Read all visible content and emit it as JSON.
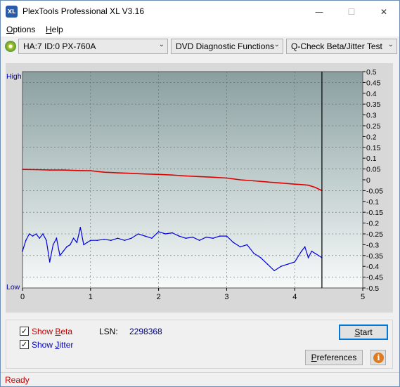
{
  "window": {
    "title": "PlexTools Professional XL V3.16",
    "icon_text": "XL",
    "minimize_glyph": "—",
    "maximize_glyph": "☐",
    "close_glyph": "✕"
  },
  "menu": {
    "items": [
      {
        "label": "Options",
        "accel": "O",
        "rest": "ptions"
      },
      {
        "label": "Help",
        "accel": "H",
        "rest": "elp"
      }
    ]
  },
  "toolbar": {
    "drive": "HA:7 ID:0  PX-760A",
    "function": "DVD Diagnostic Functions",
    "test": "Q-Check Beta/Jitter Test",
    "dropdown_glyph": "⌄"
  },
  "chart_data": {
    "type": "line",
    "title": "",
    "xlabel": "",
    "ylabel": "",
    "left_labels": {
      "high": "High",
      "low": "Low"
    },
    "xlim": [
      0,
      5
    ],
    "ylim": [
      -0.5,
      0.5
    ],
    "x_ticks": [
      "0",
      "1",
      "2",
      "3",
      "4",
      "5"
    ],
    "y_ticks": [
      "0.5",
      "0.45",
      "0.4",
      "0.35",
      "0.3",
      "0.25",
      "0.2",
      "0.15",
      "0.1",
      "0.05",
      "0",
      "-0.05",
      "-0.1",
      "-0.15",
      "-0.2",
      "-0.25",
      "-0.3",
      "-0.35",
      "-0.4",
      "-0.45",
      "-0.5"
    ],
    "grid": true,
    "end_marker_x": 4.4,
    "series": [
      {
        "name": "Beta",
        "color": "#e00000",
        "x": [
          0,
          0.2,
          0.4,
          0.6,
          0.8,
          1.0,
          1.2,
          1.4,
          1.6,
          1.8,
          2.0,
          2.2,
          2.4,
          2.6,
          2.8,
          3.0,
          3.2,
          3.4,
          3.6,
          3.8,
          4.0,
          4.1,
          4.2,
          4.3,
          4.4
        ],
        "values": [
          0.048,
          0.047,
          0.045,
          0.045,
          0.043,
          0.042,
          0.035,
          0.032,
          0.03,
          0.027,
          0.025,
          0.022,
          0.018,
          0.015,
          0.012,
          0.008,
          0.0,
          -0.005,
          -0.01,
          -0.015,
          -0.02,
          -0.022,
          -0.025,
          -0.035,
          -0.05
        ]
      },
      {
        "name": "Jitter",
        "color": "#0000e0",
        "x": [
          0,
          0.05,
          0.1,
          0.15,
          0.2,
          0.25,
          0.3,
          0.35,
          0.4,
          0.45,
          0.5,
          0.55,
          0.6,
          0.65,
          0.7,
          0.75,
          0.8,
          0.85,
          0.9,
          0.95,
          1.0,
          1.1,
          1.2,
          1.3,
          1.4,
          1.5,
          1.6,
          1.7,
          1.8,
          1.9,
          2.0,
          2.1,
          2.2,
          2.3,
          2.4,
          2.5,
          2.6,
          2.7,
          2.8,
          2.9,
          3.0,
          3.1,
          3.2,
          3.3,
          3.4,
          3.5,
          3.6,
          3.7,
          3.8,
          3.9,
          4.0,
          4.1,
          4.15,
          4.2,
          4.25,
          4.3,
          4.35,
          4.4
        ],
        "values": [
          -0.33,
          -0.28,
          -0.25,
          -0.26,
          -0.25,
          -0.27,
          -0.25,
          -0.28,
          -0.38,
          -0.3,
          -0.27,
          -0.35,
          -0.33,
          -0.31,
          -0.3,
          -0.27,
          -0.29,
          -0.22,
          -0.3,
          -0.29,
          -0.28,
          -0.28,
          -0.275,
          -0.28,
          -0.27,
          -0.28,
          -0.27,
          -0.25,
          -0.26,
          -0.27,
          -0.24,
          -0.25,
          -0.245,
          -0.26,
          -0.27,
          -0.265,
          -0.28,
          -0.265,
          -0.27,
          -0.26,
          -0.26,
          -0.29,
          -0.31,
          -0.3,
          -0.34,
          -0.36,
          -0.39,
          -0.42,
          -0.4,
          -0.39,
          -0.38,
          -0.33,
          -0.31,
          -0.36,
          -0.33,
          -0.34,
          -0.35,
          -0.36
        ]
      }
    ]
  },
  "options": {
    "show_beta": {
      "checked": true,
      "check_glyph": "✓",
      "pre": "Show ",
      "accel": "B",
      "rest": "eta",
      "color": "#c00000"
    },
    "show_jitter": {
      "checked": true,
      "check_glyph": "✓",
      "pre": "Show ",
      "accel": "J",
      "rest": "itter",
      "color": "#0000c0"
    },
    "lsn_label": "LSN:",
    "lsn_value": "2298368"
  },
  "buttons": {
    "start": {
      "accel": "S",
      "rest": "tart"
    },
    "preferences": {
      "accel": "P",
      "rest": "references"
    },
    "info_glyph": "i"
  },
  "status": {
    "text": "Ready"
  }
}
